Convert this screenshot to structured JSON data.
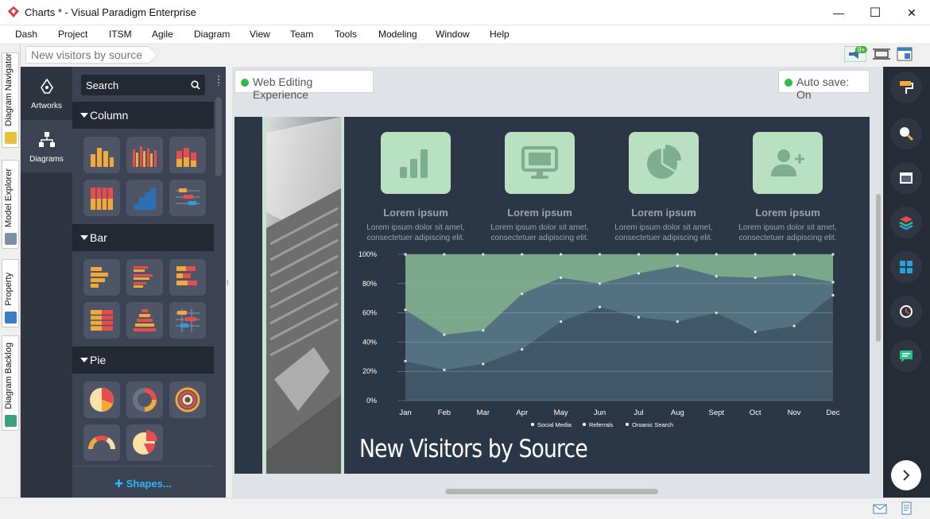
{
  "window": {
    "title": "Charts * - Visual Paradigm Enterprise",
    "controls": {
      "minimize": "—",
      "maximize": "☐",
      "close": "✕"
    }
  },
  "menu": [
    "Dash",
    "Project",
    "ITSM",
    "Agile",
    "Diagram",
    "View",
    "Team",
    "Tools",
    "Modeling",
    "Window",
    "Help"
  ],
  "breadcrumb": "New visitors by source",
  "toolbar_badge": "9+",
  "left_tabs": [
    "Diagram Navigator",
    "Model Explorer",
    "Property",
    "Diagram Backlog"
  ],
  "rail": {
    "artworks": "Artworks",
    "diagrams": "Diagrams"
  },
  "panel": {
    "search_placeholder": "Search",
    "categories": [
      "Column",
      "Bar",
      "Pie"
    ],
    "more_shapes": "✚  Shapes..."
  },
  "canvas": {
    "web_editing": "Web Editing Experience",
    "auto_save": "Auto save: On",
    "status_color": "#2ebd4a"
  },
  "infographic": {
    "features": [
      {
        "icon": "bar-chart-icon",
        "heading": "Lorem ipsum",
        "text_line1": "Lorem ipsum dolor sit amet,",
        "text_line2": "consectetuer adipiscing elit."
      },
      {
        "icon": "monitor-icon",
        "heading": "Lorem ipsum",
        "text_line1": "Lorem ipsum dolor sit amet,",
        "text_line2": "consectetuer adipiscing elit."
      },
      {
        "icon": "pie-chart-icon",
        "heading": "Lorem ipsum",
        "text_line1": "Lorem ipsum dolor sit amet,",
        "text_line2": "consectetuer adipiscing elit."
      },
      {
        "icon": "add-user-icon",
        "heading": "Lorem ipsum",
        "text_line1": "Lorem ipsum dolor sit amet,",
        "text_line2": "consectetuer adipiscing elit."
      }
    ],
    "title": "New Visitors by Source",
    "background": "#2b3647",
    "accent": "#b9e0c1"
  },
  "chart_data": {
    "type": "area",
    "title": "",
    "xlabel": "",
    "ylabel": "",
    "categories": [
      "Jan",
      "Feb",
      "Mar",
      "Apr",
      "May",
      "Jun",
      "Jul",
      "Aug",
      "Sept",
      "Oct",
      "Nov",
      "Dec"
    ],
    "yticks": [
      "0%",
      "20%",
      "40%",
      "60%",
      "80%",
      "100%"
    ],
    "ylim": [
      0,
      100
    ],
    "grid": true,
    "legend_position": "bottom",
    "series": [
      {
        "name": "Social Media",
        "color": "#7fae8f",
        "values": [
          100,
          100,
          100,
          100,
          100,
          100,
          100,
          100,
          100,
          100,
          100,
          100
        ]
      },
      {
        "name": "Referrals",
        "color": "#4f6b7e",
        "values": [
          62,
          45,
          48,
          73,
          84,
          80,
          87,
          92,
          85,
          84,
          86,
          81
        ]
      },
      {
        "name": "Organic Search",
        "color": "#3f5567",
        "values": [
          27,
          21,
          25,
          35,
          54,
          64,
          57,
          54,
          60,
          47,
          51,
          72
        ]
      }
    ]
  }
}
